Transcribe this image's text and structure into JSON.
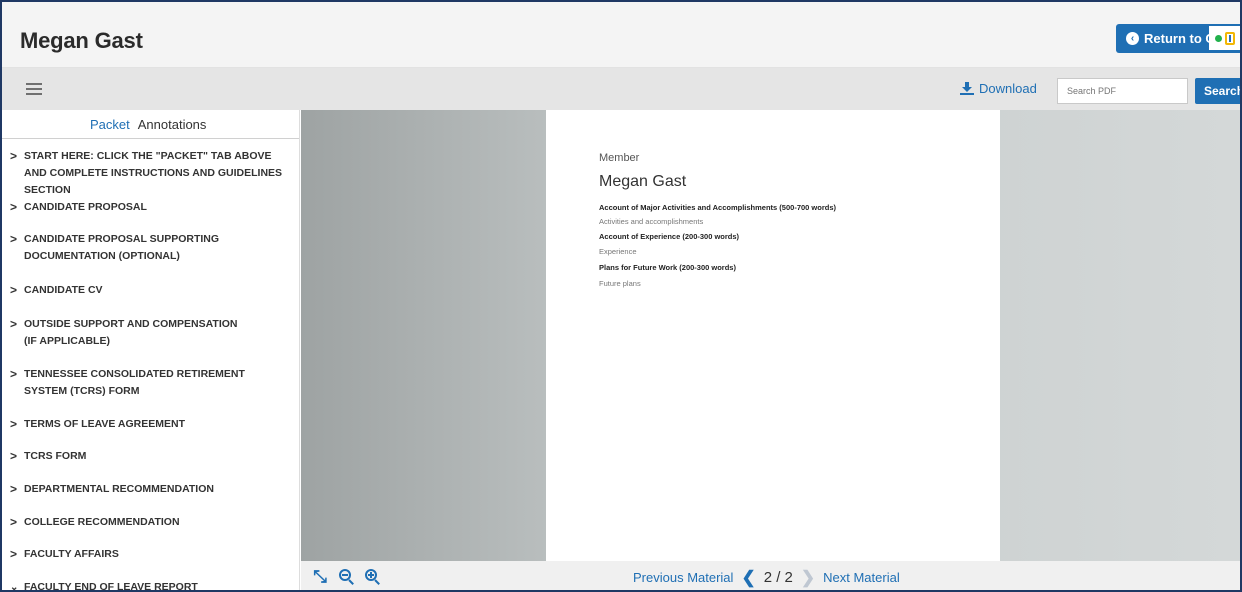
{
  "header": {
    "title": "Megan Gast",
    "return_label": "Return to Ca"
  },
  "toolbar": {
    "download_label": "Download",
    "search_placeholder": "Search PDF",
    "search_button": "Search"
  },
  "sidebar": {
    "tabs": [
      {
        "label": "Packet",
        "active": true
      },
      {
        "label": "Annotations",
        "active": false
      }
    ],
    "items": [
      {
        "label": "START HERE: CLICK THE \"PACKET\" TAB ABOVE AND COMPLETE INSTRUCTIONS AND GUIDELINES SECTION",
        "expanded": false
      },
      {
        "label": "CANDIDATE PROPOSAL",
        "expanded": false
      },
      {
        "label": "CANDIDATE PROPOSAL SUPPORTING DOCUMENTATION (OPTIONAL)",
        "expanded": false
      },
      {
        "label": "CANDIDATE CV",
        "expanded": false
      },
      {
        "label": "OUTSIDE SUPPORT AND COMPENSATION (IF APPLICABLE)",
        "expanded": false
      },
      {
        "label": "TENNESSEE CONSOLIDATED RETIREMENT SYSTEM (TCRS) FORM",
        "expanded": false
      },
      {
        "label": "TERMS OF LEAVE AGREEMENT",
        "expanded": false
      },
      {
        "label": "TCRS FORM",
        "expanded": false
      },
      {
        "label": "DEPARTMENTAL RECOMMENDATION",
        "expanded": false
      },
      {
        "label": "COLLEGE RECOMMENDATION",
        "expanded": false
      },
      {
        "label": "FACULTY AFFAIRS",
        "expanded": false
      },
      {
        "label": "FACULTY END OF LEAVE REPORT",
        "expanded": true
      }
    ]
  },
  "document": {
    "member_label": "Member",
    "member_name": "Megan Gast",
    "sections": [
      {
        "heading": "Account of Major Activities and Accomplishments (500-700 words)",
        "body": "Activities and accomplishments"
      },
      {
        "heading": "Account of Experience (200-300 words)",
        "body": "Experience"
      },
      {
        "heading": "Plans for Future Work (200-300 words)",
        "body": "Future plans"
      }
    ]
  },
  "pager": {
    "previous_label": "Previous Material",
    "current_page": "2",
    "total_pages": "2",
    "page_display": "2 / 2",
    "next_label": "Next Material"
  },
  "icons": {
    "fit": "expand-icon",
    "zoom_out": "zoom-out-icon",
    "zoom_in": "zoom-in-icon"
  },
  "colors": {
    "accent": "#1f6fb4",
    "frame": "#1f3864"
  }
}
